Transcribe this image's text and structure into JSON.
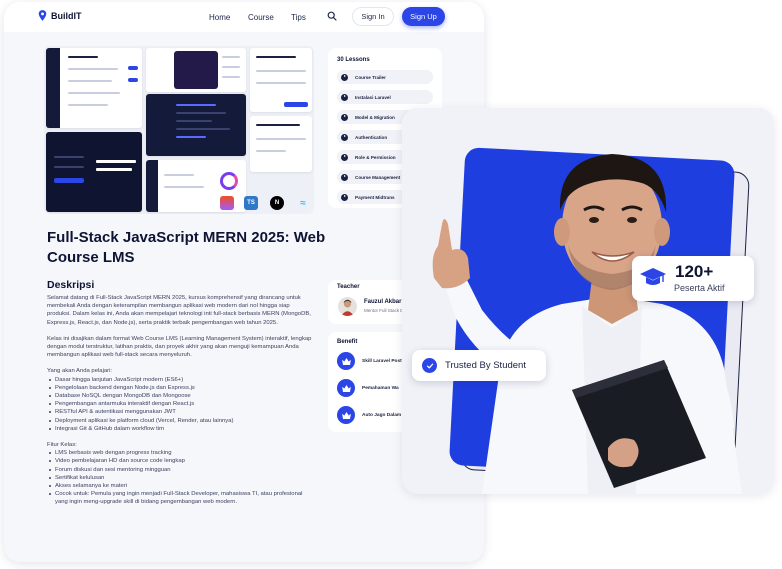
{
  "nav": {
    "brand": "BuildIT",
    "links": [
      "Home",
      "Course",
      "Tips"
    ],
    "signin": "Sign In",
    "signup": "Sign Up"
  },
  "course": {
    "title": "Full-Stack JavaScript MERN 2025: Web Course LMS",
    "desc_heading": "Deskripsi",
    "intro_1": "Selamat datang di Full-Stack JavaScript MERN 2025, kursus komprehensif yang dirancang untuk membekali Anda dengan keterampilan membangun aplikasi web modern dari nol hingga siap produksi. Dalam kelas ini, Anda akan mempelajari teknologi inti full-stack berbasis MERN (MongoDB, Express.js, React.js, dan Node.js), serta praktik terbaik pengembangan web tahun 2025.",
    "intro_2": "Kelas ini disajikan dalam format Web Course LMS (Learning Management System) interaktif, lengkap dengan modul terstruktur, latihan praktis, dan proyek akhir yang akan menguji kemampuan Anda membangun aplikasi web full-stack secara menyeluruh.",
    "learn_heading": "Yang akan Anda pelajari:",
    "learn_items": [
      "Dasar hingga lanjutan JavaScript modern (ES6+)",
      "Pengelolaan backend dengan Node.js dan Express.js",
      "Database NoSQL dengan MongoDB dan Mongoose",
      "Pengembangan antarmuka interaktif dengan React.js",
      "RESTful API & autentikasi menggunakan JWT",
      "Deployment aplikasi ke platform cloud (Vercel, Render, atau lainnya)",
      "Integrasi Git & GitHub dalam workflow tim"
    ],
    "feature_heading": "Fitur Kelas:",
    "feature_items": [
      "LMS berbasis web dengan progress tracking",
      "Video pembelajaran HD dan source code lengkap",
      "Forum diskusi dan sesi mentoring mingguan",
      "Sertifikat kelulusan",
      "Akses selamanya ke materi",
      "Cocok untuk: Pemula yang ingin menjadi Full-Stack Developer, mahasiswa TI, atau profesional yang ingin meng-upgrade skill di bidang pengembangan web modern."
    ]
  },
  "lessons": {
    "heading": "30 Lessons",
    "items": [
      "Course Trailer",
      "Instalasi Laravel",
      "Model & Migration",
      "Authentication",
      "Role & Permission",
      "Course Management",
      "Payment Midtrans"
    ]
  },
  "teacher": {
    "heading": "Teacher",
    "name": "Fauzul Akbar",
    "role": "Mentor Full Stack D"
  },
  "benefit": {
    "heading": "Benefit",
    "items": [
      "Skill Laravel Posti",
      "Pemahaman Wa",
      "Auto Jago Dalam"
    ]
  },
  "hero": {
    "stat_number": "120+",
    "stat_label": "Peserta Aktif",
    "trusted": "Trusted By Student"
  },
  "tech_badges": [
    "TS",
    "N"
  ],
  "colors": {
    "accent": "#2b45e6",
    "dark": "#0e1433",
    "hero_blue": "#1f3ee0"
  }
}
